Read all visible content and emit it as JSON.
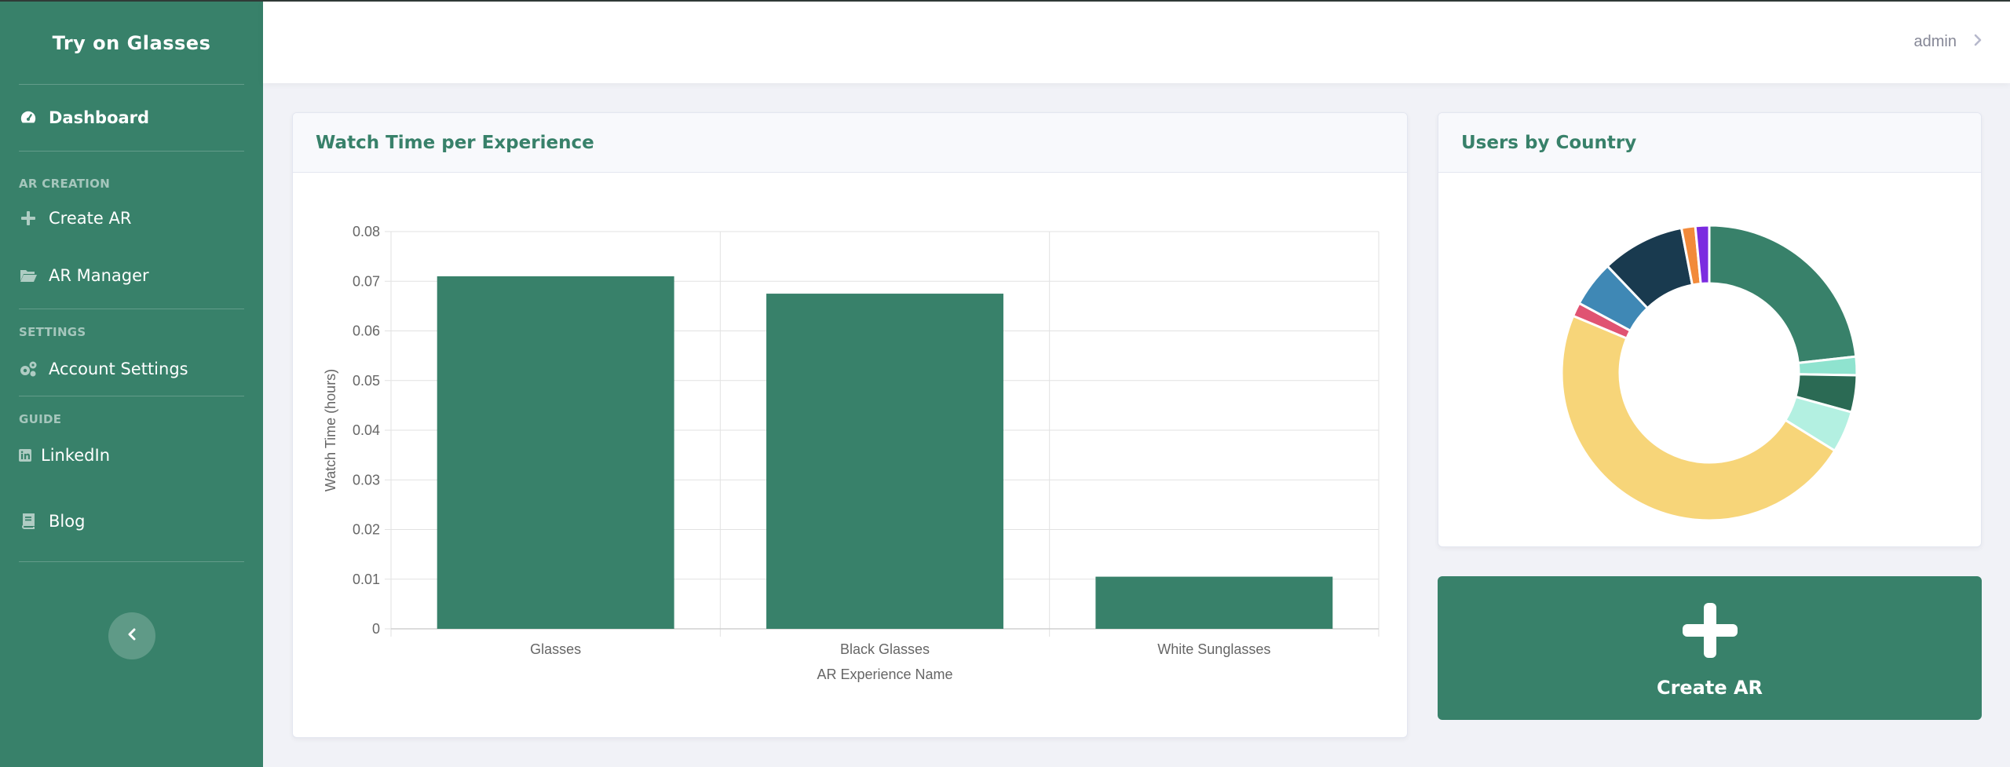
{
  "sidebar": {
    "brand": "Try on Glasses",
    "dashboard": "Dashboard",
    "section_ar": "AR CREATION",
    "create_ar": "Create AR",
    "ar_manager": "AR Manager",
    "section_settings": "SETTINGS",
    "account_settings": "Account Settings",
    "section_guide": "GUIDE",
    "linkedin": "LinkedIn",
    "blog": "Blog",
    "toggle_icon": "chevron-left-icon"
  },
  "topbar": {
    "user_name": "admin",
    "user_icon": "chevron-right-icon"
  },
  "watch_card": {
    "title": "Watch Time per Experience"
  },
  "country_card": {
    "title": "Users by Country"
  },
  "create_card": {
    "label": "Create AR",
    "icon": "plus-icon"
  },
  "colors": {
    "primary": "#38816a",
    "sidebar": "#38816a",
    "background": "#f1f2f7"
  },
  "chart_data": [
    {
      "type": "bar",
      "categories": [
        "Glasses",
        "Black Glasses",
        "White Sunglasses"
      ],
      "values": [
        0.071,
        0.0675,
        0.0105
      ],
      "xlabel": "AR Experience Name",
      "ylabel": "Watch Time (hours)",
      "ylim": [
        0,
        0.08
      ],
      "yticks": [
        "0",
        "0.01",
        "0.02",
        "0.03",
        "0.04",
        "0.05",
        "0.06",
        "0.07",
        "0.08"
      ],
      "grid": true,
      "color": "#38816a"
    },
    {
      "type": "pie",
      "donut": true,
      "values": [
        23.0,
        2.0,
        4.0,
        4.5,
        47.0,
        1.5,
        5.0,
        9.0,
        1.5,
        1.5
      ],
      "colors": [
        "#38816a",
        "#8fe3cf",
        "#2b6a54",
        "#b3f0e1",
        "#f7d579",
        "#e05372",
        "#3f88b5",
        "#193a4f",
        "#f28a3a",
        "#7b2be0"
      ]
    }
  ]
}
